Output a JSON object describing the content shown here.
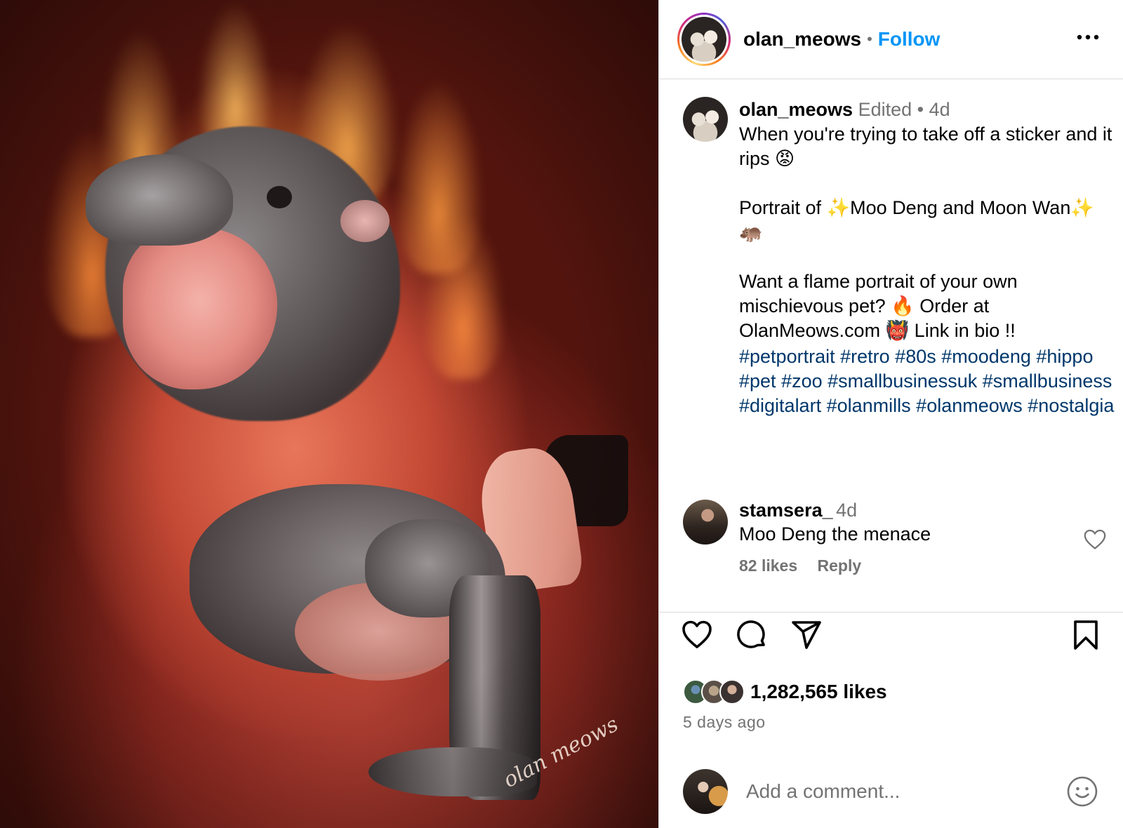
{
  "post_image": {
    "alt_subject": "pigmy hippo flame portrait",
    "signature": "olan meows"
  },
  "header": {
    "username": "olan_meows",
    "separator": "•",
    "follow_label": "Follow",
    "more_icon": "more-horizontal-icon"
  },
  "caption": {
    "username": "olan_meows",
    "edited": "Edited",
    "dot": "•",
    "time": "4d",
    "text": "When you're trying to take off a sticker and it rips 😡\n\nPortrait of ✨Moo Deng and Moon Wan✨ 🦛\n\nWant a flame portrait of your own mischievous pet? 🔥 Order at OlanMeows.com 👹 Link in bio !!\n",
    "hashtags": [
      "#petportrait",
      "#retro",
      "#80s",
      "#moodeng",
      "#hippo",
      "#pet",
      "#zoo",
      "#smallbusinessuk",
      "#smallbusiness",
      "#digitalart",
      "#olanmills",
      "#olanmeows",
      "#nostalgia"
    ]
  },
  "comment": {
    "username": "stamsera_",
    "time": "4d",
    "text": "Moo Deng the menace",
    "likes": "82 likes",
    "reply_label": "Reply",
    "like_icon": "heart-outline-icon"
  },
  "actions": {
    "like_icon": "heart-icon",
    "comment_icon": "comment-bubble-icon",
    "share_icon": "send-icon",
    "save_icon": "bookmark-icon",
    "likes_count": "1,282,565 likes",
    "time_ago": "5 days ago"
  },
  "add_comment": {
    "placeholder": "Add a comment...",
    "emoji_icon": "smiley-face-icon"
  },
  "colors": {
    "follow": "#0095f6",
    "hashtag": "#00376b",
    "muted": "#737373",
    "divider": "#dbdbdb"
  }
}
